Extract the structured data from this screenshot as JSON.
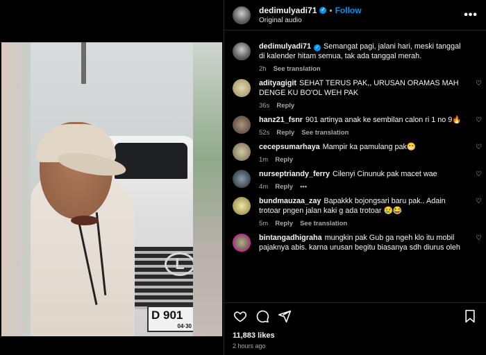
{
  "header": {
    "username": "dedimulyadi71",
    "separator": "•",
    "follow_label": "Follow",
    "audio": "Original audio"
  },
  "video": {
    "plate_number": "D 901",
    "plate_sub": "04·30"
  },
  "comments": [
    {
      "username": "dedimulyadi71",
      "text": "Semangat pagi, jalani hari, meski tanggal di kalender hitam semua, tak ada tanggal merah.",
      "time": "2h",
      "see_translation": "See translation",
      "avatar_color": "#9a9a9a"
    },
    {
      "username": "aditv agigit",
      "display_username": "adityagigit",
      "text": "SEHAT TERUS PAK,, URUSAN ORAMAS MAH DENGE KU BO'OL WEH PAK",
      "time": "36s",
      "reply": "Reply",
      "avatar_color": "#c8b88a"
    },
    {
      "display_username": "hanz21_fsnr",
      "text": "901 artinya anak ke sembilan calon ri 1 no 9🔥",
      "time": "52s",
      "reply": "Reply",
      "see_translation": "See translation",
      "avatar_color": "#7a6a58"
    },
    {
      "display_username": "cecepsumarhaya",
      "text": "Mampir ka pamulang pak😁",
      "time": "1m",
      "reply": "Reply",
      "avatar_color": "#a59a7c"
    },
    {
      "display_username": "nurseptriandy_ferry",
      "text": "Cilenyi Cinunuk pak macet wae",
      "time": "4m",
      "reply": "Reply",
      "more": "•••",
      "avatar_color": "#3c4a55"
    },
    {
      "display_username": "bundmauzaa_zay",
      "text": "Bapakkk bojongsari baru pak.. Adain trotoar pngen jalan kaki g ada trotoar 😢😂",
      "time": "5m",
      "reply": "Reply",
      "see_translation": "See translation",
      "avatar_color": "#d2c48a"
    },
    {
      "display_username": "bintangadhigraha",
      "text": "mungkin pak Gub ga ngeh klo itu mobil pajaknya abis. karna urusan begitu biasanya sdh diurus oleh",
      "avatar_color": "#8a7a6a"
    }
  ],
  "footer": {
    "likes": "11,883 likes",
    "time": "2 hours ago"
  },
  "colors": {
    "accent": "#0095f6",
    "background": "#000000",
    "muted_text": "#a8a8a8"
  },
  "icons": [
    "heart-icon",
    "comment-icon",
    "share-icon",
    "bookmark-icon",
    "more-icon",
    "verified-icon"
  ]
}
